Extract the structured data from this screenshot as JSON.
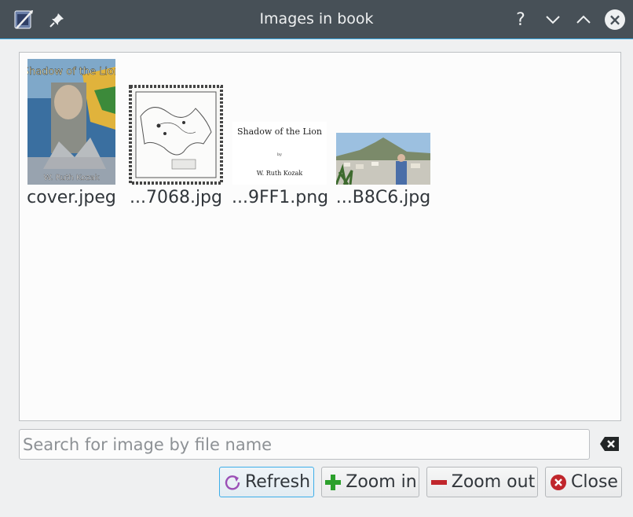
{
  "window": {
    "title": "Images in book"
  },
  "titlebar": {
    "help_glyph": "?",
    "minimize_glyph": "⌄",
    "maximize_glyph": "⌃",
    "close_glyph": "×"
  },
  "images": [
    {
      "filename": "cover.jpeg",
      "thumb_title": "Shadow of the Lion",
      "thumb_author": "W. Ruth Kozak"
    },
    {
      "filename": "...7068.jpg"
    },
    {
      "filename": "...9FF1.png",
      "thumb_title": "Shadow of the Lion",
      "thumb_by": "by",
      "thumb_author": "W. Ruth Kozak"
    },
    {
      "filename": "...B8C6.jpg"
    }
  ],
  "search": {
    "placeholder": "Search for image by file name",
    "value": ""
  },
  "buttons": {
    "refresh": "Refresh",
    "zoom_in": "Zoom in",
    "zoom_out": "Zoom out",
    "close": "Close"
  },
  "colors": {
    "titlebar": "#475057",
    "accent": "#3daee9",
    "zoom_in_green": "#2ca02c",
    "close_red": "#c0262c",
    "refresh_purple": "#9b4fb6"
  }
}
